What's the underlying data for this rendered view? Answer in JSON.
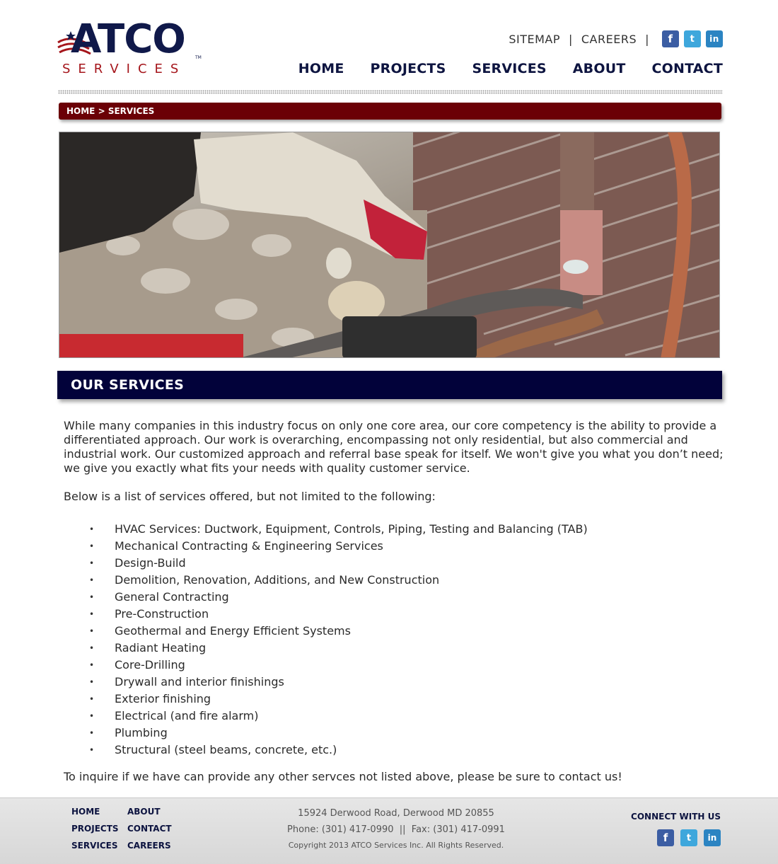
{
  "brand": {
    "name": "ATCO",
    "sub": "SERVICES",
    "tm": "TM"
  },
  "util": {
    "sitemap": "SITEMAP",
    "careers": "CAREERS",
    "sep": "|"
  },
  "social": {
    "fb": "f",
    "tw": "t",
    "li": "in"
  },
  "nav": [
    "HOME",
    "PROJECTS",
    "SERVICES",
    "ABOUT",
    "CONTACT"
  ],
  "breadcrumb": {
    "home": "HOME",
    "sep": ">",
    "current": "SERVICES"
  },
  "banner": "OUR SERVICES",
  "content": {
    "intro": "While many companies in this industry focus on only one core area, our core competency is the ability to provide a differentiated approach. Our work is overarching, encompassing not only residential, but also commercial and industrial work. Our customized approach and referral base speak for itself. We won't give you what you don’t need; we give you exactly what fits your needs with quality customer service.",
    "below": "Below is a list of services offered, but not limited to the following:",
    "bullet": "•",
    "services": [
      "HVAC Services: Ductwork, Equipment, Controls, Piping, Testing and Balancing (TAB)",
      "Mechanical Contracting & Engineering Services",
      "Design-Build",
      "Demolition, Renovation, Additions, and New Construction",
      "General Contracting",
      "Pre-Construction",
      "Geothermal and Energy Efficient Systems",
      "Radiant Heating",
      "Core-Drilling",
      "Drywall and interior finishings",
      "Exterior finishing",
      "Electrical (and fire alarm)",
      "Plumbing",
      "Structural (steel beams, concrete, etc.)"
    ],
    "closing": "To inquire if we have can provide any other servces not listed above, please be sure to contact us!"
  },
  "footer": {
    "nav": [
      "HOME",
      "ABOUT",
      "PROJECTS",
      "CONTACT",
      "SERVICES",
      "CAREERS"
    ],
    "address": "15924 Derwood Road, Derwood MD 20855",
    "phones": "Phone: (301) 417-0990  ||  Fax: (301) 417-0991",
    "copyright": "Copyright 2013 ATCO Services Inc. All Rights Reserved.",
    "connect": "CONNECT WITH US"
  },
  "colors": {
    "navy": "#0d1440",
    "banner": "#02023a",
    "crumb": "#6b0006",
    "brand_red": "#a5151b"
  }
}
